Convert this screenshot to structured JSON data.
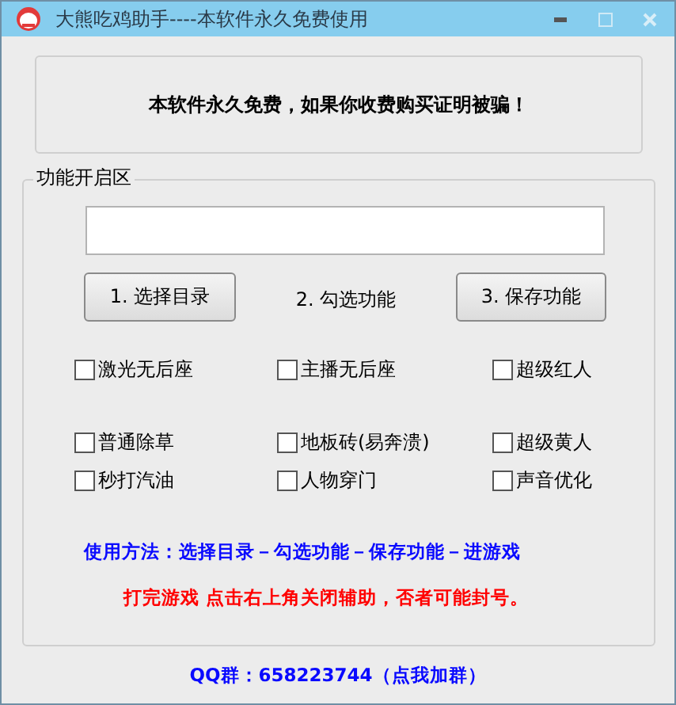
{
  "window": {
    "title": "大熊吃鸡助手----本软件永久免费使用"
  },
  "notice": "本软件永久免费，如果你收费购买证明被骗！",
  "group": {
    "title": "功能开启区",
    "steps": [
      {
        "kind": "button",
        "label": "1. 选择目录"
      },
      {
        "kind": "label",
        "label": "2. 勾选功能"
      },
      {
        "kind": "button",
        "label": "3. 保存功能"
      }
    ],
    "option_rows": [
      [
        {
          "label": "激光无后座",
          "checked": false
        },
        {
          "label": "主播无后座",
          "checked": false
        },
        {
          "label": "超级红人",
          "checked": false
        }
      ],
      [
        {
          "label": "普通除草",
          "checked": false
        },
        {
          "label": "地板砖(易奔溃)",
          "checked": false
        },
        {
          "label": "超级黄人",
          "checked": false
        }
      ],
      [
        {
          "label": "秒打汽油",
          "checked": false
        },
        {
          "label": "人物穿门",
          "checked": false
        },
        {
          "label": "声音优化",
          "checked": false
        }
      ]
    ],
    "usage": "使用方法：选择目录－勾选功能－保存功能－进游戏",
    "warning": "打完游戏 点击右上角关闭辅助，否者可能封号。"
  },
  "qq_group": "QQ群：658223744（点我加群）"
}
